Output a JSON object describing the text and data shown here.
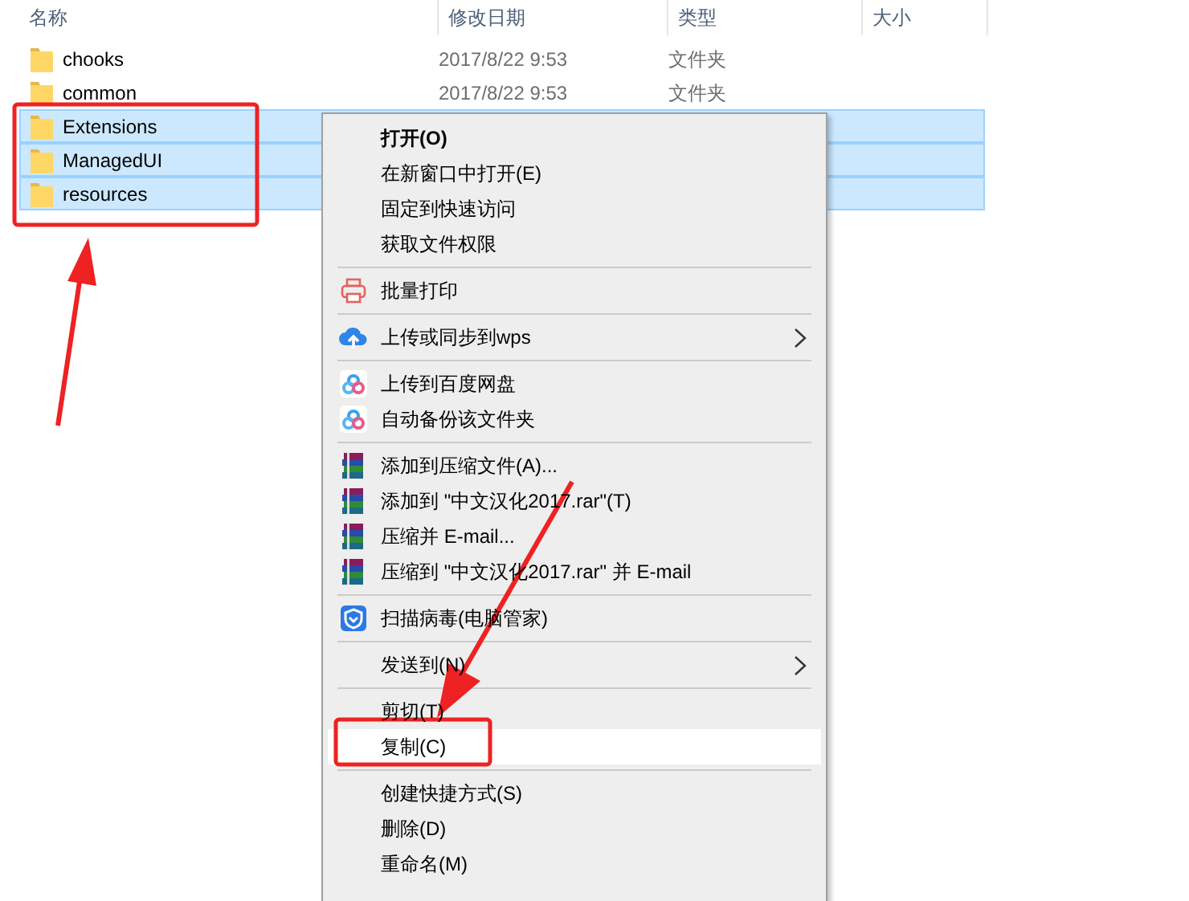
{
  "columns": [
    {
      "label": "名称"
    },
    {
      "label": "修改日期"
    },
    {
      "label": "类型"
    },
    {
      "label": "大小"
    }
  ],
  "files": [
    {
      "name": "chooks",
      "date": "2017/8/22 9:53",
      "type": "文件夹",
      "selected": false
    },
    {
      "name": "common",
      "date": "2017/8/22 9:53",
      "type": "文件夹",
      "selected": false
    },
    {
      "name": "Extensions",
      "selected": true
    },
    {
      "name": "ManagedUI",
      "selected": true
    },
    {
      "name": "resources",
      "selected": true
    }
  ],
  "context_menu": [
    {
      "kind": "item",
      "label": "打开(O)",
      "bold": true,
      "highlighted": false
    },
    {
      "kind": "item",
      "label": "在新窗口中打开(E)",
      "highlighted": false
    },
    {
      "kind": "item",
      "label": "固定到快速访问",
      "highlighted": false
    },
    {
      "kind": "item",
      "label": "获取文件权限",
      "highlighted": false
    },
    {
      "kind": "separator"
    },
    {
      "kind": "print",
      "label": "批量打印",
      "highlighted": false
    },
    {
      "kind": "separator"
    },
    {
      "kind": "upload",
      "label": "上传或同步到wps",
      "submenu": true,
      "highlighted": false
    },
    {
      "kind": "separator"
    },
    {
      "kind": "netdisk",
      "label": "上传到百度网盘",
      "highlighted": false
    },
    {
      "kind": "netdisk",
      "label": "自动备份该文件夹",
      "highlighted": false
    },
    {
      "kind": "separator"
    },
    {
      "kind": "archive",
      "label": "添加到压缩文件(A)...",
      "highlighted": false
    },
    {
      "kind": "archive",
      "label": "添加到 \"中文汉化2017.rar\"(T)",
      "highlighted": false
    },
    {
      "kind": "archive",
      "label": "压缩并 E-mail...",
      "highlighted": false
    },
    {
      "kind": "archive",
      "label": "压缩到 \"中文汉化2017.rar\" 并 E-mail",
      "highlighted": false
    },
    {
      "kind": "separator"
    },
    {
      "kind": "antivirus",
      "label": "扫描病毒(电脑管家)",
      "highlighted": false
    },
    {
      "kind": "separator"
    },
    {
      "kind": "item",
      "label": "发送到(N)",
      "submenu": true,
      "highlighted": false
    },
    {
      "kind": "separator"
    },
    {
      "kind": "item",
      "label": "剪切(T)",
      "highlighted": false
    },
    {
      "kind": "item",
      "label": "复制(C)",
      "highlighted": true
    },
    {
      "kind": "separator"
    },
    {
      "kind": "item",
      "label": "创建快捷方式(S)",
      "highlighted": false
    },
    {
      "kind": "item",
      "label": "删除(D)",
      "highlighted": false
    },
    {
      "kind": "item",
      "label": "重命名(M)",
      "highlighted": false
    }
  ]
}
